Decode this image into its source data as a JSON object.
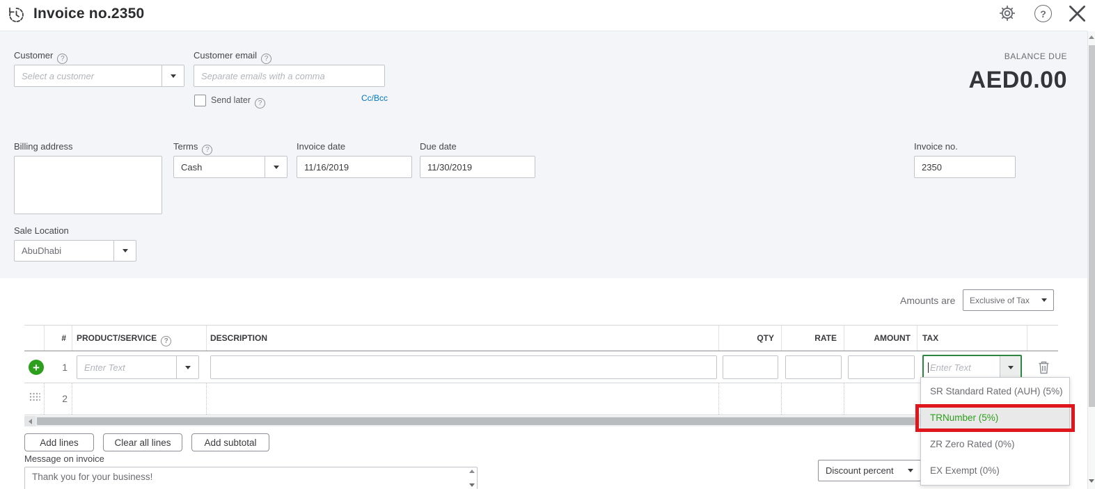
{
  "header": {
    "title": "Invoice no.2350",
    "icons": [
      "history-icon",
      "gear-icon",
      "help-icon",
      "close-icon"
    ],
    "help_glyph": "?"
  },
  "form": {
    "customer": {
      "label": "Customer",
      "placeholder": "Select a customer"
    },
    "email": {
      "label": "Customer email",
      "placeholder": "Separate emails with a comma",
      "send_later": "Send later",
      "cc_bcc": "Cc/Bcc"
    },
    "balance": {
      "label": "BALANCE DUE",
      "amount": "AED0.00"
    },
    "billing_address": {
      "label": "Billing address",
      "value": ""
    },
    "terms": {
      "label": "Terms",
      "value": "Cash"
    },
    "invoice_date": {
      "label": "Invoice date",
      "value": "11/16/2019"
    },
    "due_date": {
      "label": "Due date",
      "value": "11/30/2019"
    },
    "invoice_no": {
      "label": "Invoice no.",
      "value": "2350"
    },
    "sale_location": {
      "label": "Sale Location",
      "value": "AbuDhabi"
    },
    "amounts_are": {
      "label": "Amounts are",
      "value": "Exclusive of Tax"
    }
  },
  "table": {
    "headers": {
      "num": "#",
      "product": "PRODUCT/SERVICE",
      "description": "DESCRIPTION",
      "qty": "QTY",
      "rate": "RATE",
      "amount": "AMOUNT",
      "tax": "TAX"
    },
    "row1": {
      "num": "1",
      "product_placeholder": "Enter Text",
      "tax_placeholder": "Enter Text"
    },
    "row2": {
      "num": "2"
    }
  },
  "tax_dropdown": {
    "options": [
      {
        "label": "SR Standard Rated (AUH) (5%)",
        "highlighted": false
      },
      {
        "label": "TRNumber (5%)",
        "highlighted": true
      },
      {
        "label": "ZR Zero Rated (0%)",
        "highlighted": false
      },
      {
        "label": "EX Exempt (0%)",
        "highlighted": false
      }
    ]
  },
  "footer": {
    "add_lines": "Add lines",
    "clear_all_lines": "Clear all lines",
    "add_subtotal": "Add subtotal",
    "message": {
      "label": "Message on invoice",
      "value": "Thank you for your business!"
    },
    "discount": {
      "value": "Discount percent"
    }
  },
  "colors": {
    "accent_green": "#2ca01c",
    "link_blue": "#0077c5",
    "highlight_red": "#e0161d",
    "section_gray": "#f4f5f8"
  }
}
